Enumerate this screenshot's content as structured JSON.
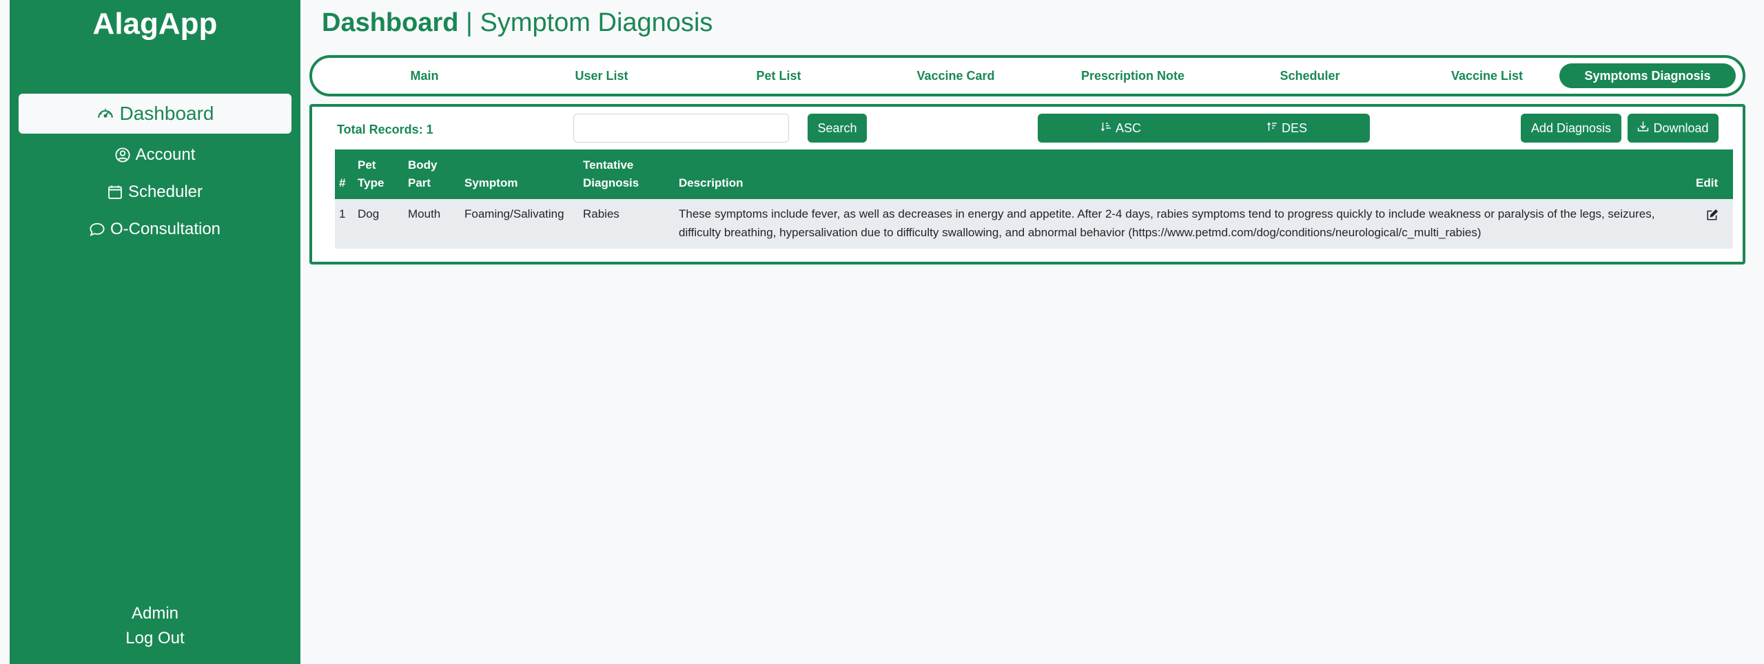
{
  "sidebar": {
    "brand": "AlagApp",
    "items": [
      {
        "label": "Dashboard",
        "icon": "speedometer-icon"
      },
      {
        "label": "Account",
        "icon": "user-circle-icon"
      },
      {
        "label": "Scheduler",
        "icon": "calendar-icon"
      },
      {
        "label": "O-Consultation",
        "icon": "chat-bubble-icon"
      }
    ],
    "user": "Admin",
    "logout": "Log Out"
  },
  "header": {
    "title_bold": "Dashboard",
    "separator": "|",
    "title_sub": "Symptom Diagnosis"
  },
  "tabs": [
    {
      "label": "Main"
    },
    {
      "label": "User List"
    },
    {
      "label": "Pet List"
    },
    {
      "label": "Vaccine Card"
    },
    {
      "label": "Prescription Note"
    },
    {
      "label": "Scheduler"
    },
    {
      "label": "Vaccine List"
    },
    {
      "label": "Symptoms Diagnosis",
      "active": true
    }
  ],
  "toolbar": {
    "total_records": "Total Records: 1",
    "search_value": "",
    "search_label": "Search",
    "asc_label": "ASC",
    "des_label": "DES",
    "add_label": "Add Diagnosis",
    "download_label": "Download"
  },
  "table": {
    "headers": {
      "num": "#",
      "pet_type": "Pet Type",
      "body_part": "Body Part",
      "symptom": "Symptom",
      "diagnosis": "Tentative Diagnosis",
      "description": "Description",
      "edit": "Edit"
    },
    "rows": [
      {
        "num": "1",
        "pet_type": "Dog",
        "body_part": "Mouth",
        "symptom": "Foaming/Salivating",
        "diagnosis": "Rabies",
        "description": "These symptoms include fever, as well as decreases in energy and appetite. After 2-4 days, rabies symptoms tend to progress quickly to include weakness or paralysis of the legs, seizures, difficulty breathing, hypersalivation due to difficulty swallowing, and abnormal behavior (https://www.petmd.com/dog/conditions/neurological/c_multi_rabies)"
      }
    ]
  },
  "colors": {
    "brand_green": "#198754",
    "background": "#f8f9fa",
    "row_background": "#e9ecef"
  }
}
